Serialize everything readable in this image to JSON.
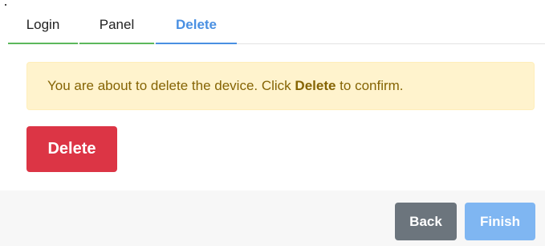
{
  "tabs": [
    {
      "label": "Login",
      "state": "completed"
    },
    {
      "label": "Panel",
      "state": "completed"
    },
    {
      "label": "Delete",
      "state": "active"
    }
  ],
  "alert": {
    "text_before": "You are about to delete the device. Click ",
    "emphasis": "Delete",
    "text_after": " to confirm."
  },
  "actions": {
    "delete_label": "Delete"
  },
  "footer": {
    "back_label": "Back",
    "finish_label": "Finish"
  },
  "colors": {
    "completed_tab": "#5cb85c",
    "active_tab": "#4a90e2",
    "alert_background": "#fff3cd",
    "alert_text": "#856404",
    "danger": "#dc3545",
    "secondary": "#6c757d",
    "primary_disabled": "#7fb6f2"
  }
}
